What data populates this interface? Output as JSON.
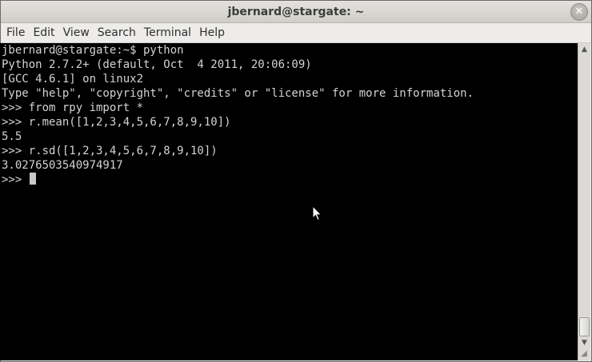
{
  "window": {
    "title": "jbernard@stargate: ~",
    "close_icon": "close-icon"
  },
  "menu": {
    "items": [
      {
        "label": "File"
      },
      {
        "label": "Edit"
      },
      {
        "label": "View"
      },
      {
        "label": "Search"
      },
      {
        "label": "Terminal"
      },
      {
        "label": "Help"
      }
    ]
  },
  "terminal": {
    "lines": [
      "jbernard@stargate:~$ python",
      "Python 2.7.2+ (default, Oct  4 2011, 20:06:09)",
      "[GCC 4.6.1] on linux2",
      "Type \"help\", \"copyright\", \"credits\" or \"license\" for more information.",
      ">>> from rpy import *",
      ">>> r.mean([1,2,3,4,5,6,7,8,9,10])",
      "5.5",
      ">>> r.sd([1,2,3,4,5,6,7,8,9,10])",
      "3.0276503540974917"
    ],
    "prompt": ">>> "
  },
  "colors": {
    "terminal_bg": "#000000",
    "terminal_fg": "#d3d3d3",
    "chrome_bg": "#edeceb"
  }
}
